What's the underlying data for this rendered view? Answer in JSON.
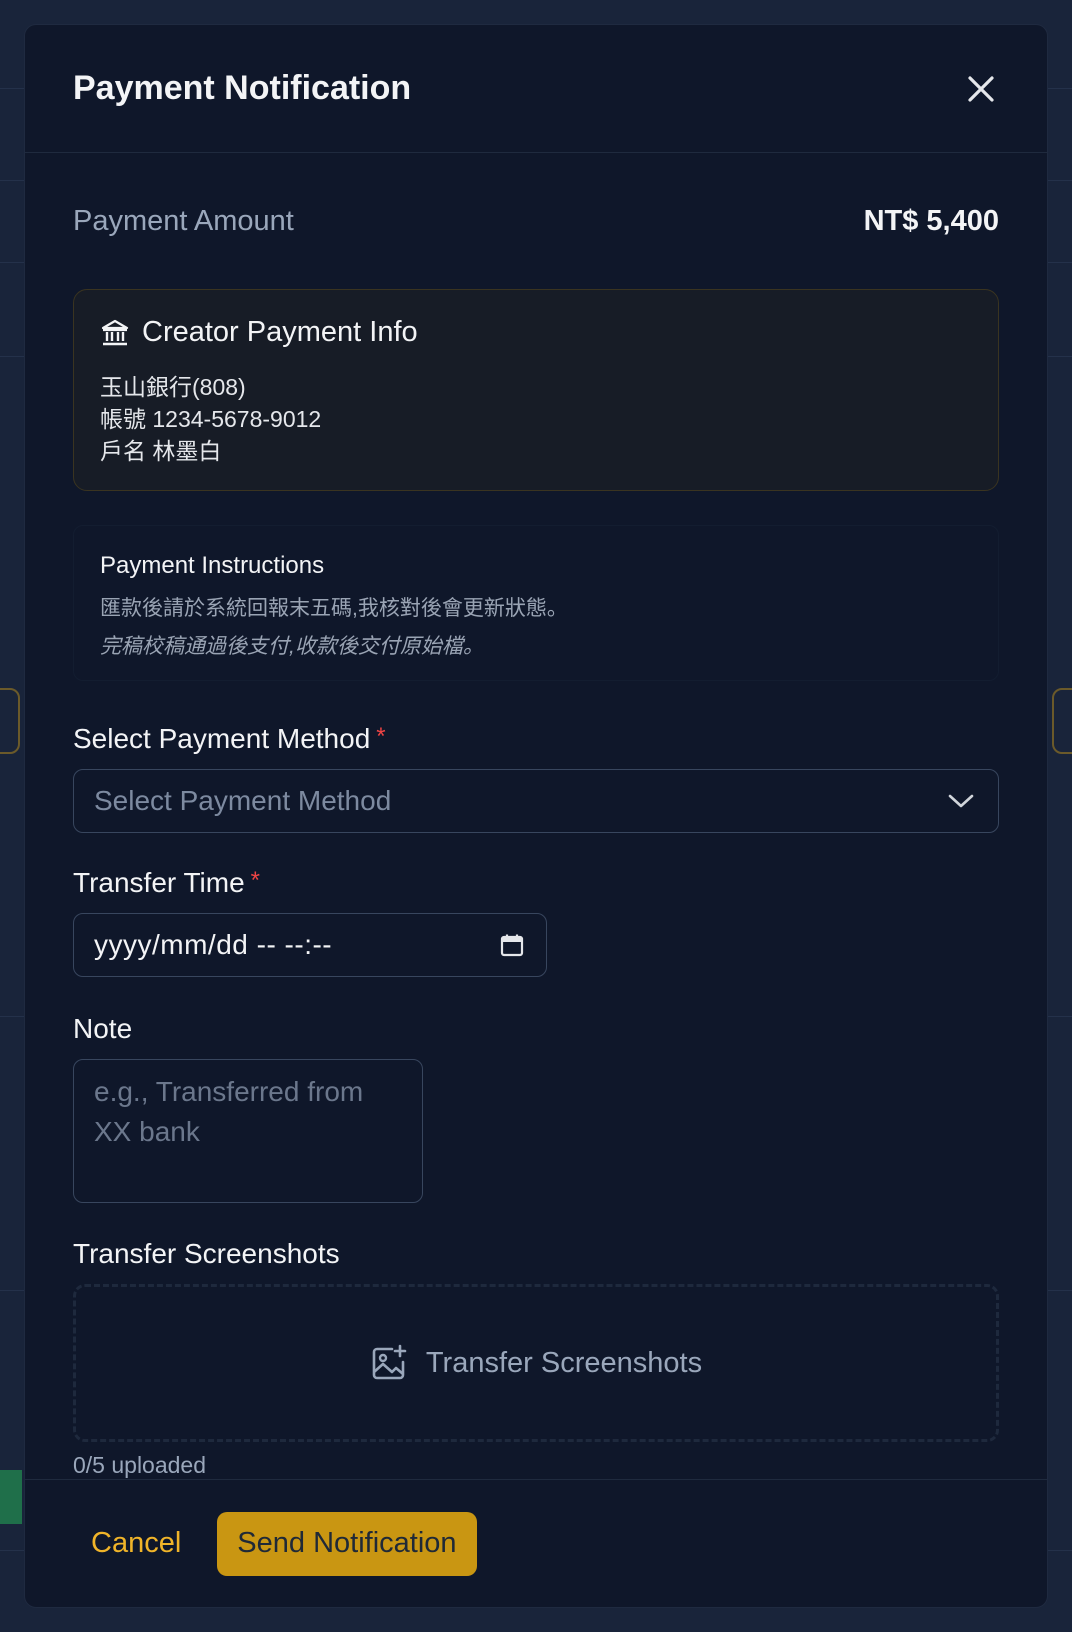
{
  "modal": {
    "title": "Payment Notification"
  },
  "amount": {
    "label": "Payment Amount",
    "value": "NT$ 5,400"
  },
  "creator_info": {
    "title": "Creator Payment Info",
    "icon": "bank-icon",
    "lines": [
      "玉山銀行(808)",
      "帳號 1234-5678-9012",
      "戶名 林墨白"
    ]
  },
  "instructions": {
    "title": "Payment Instructions",
    "line1": "匯款後請於系統回報末五碼,我核對後會更新狀態。",
    "line2": "完稿校稿通過後支付,收款後交付原始檔。"
  },
  "payment_method": {
    "label": "Select Payment Method",
    "required_mark": "*",
    "placeholder": "Select Payment Method"
  },
  "transfer_time": {
    "label": "Transfer Time",
    "required_mark": "*",
    "placeholder": "yyyy/mm/dd -- --:--"
  },
  "note": {
    "label": "Note",
    "placeholder": "e.g., Transferred from XX bank"
  },
  "screenshots": {
    "label": "Transfer Screenshots",
    "dropzone_text": "Transfer Screenshots",
    "count": "0/5 uploaded"
  },
  "footer": {
    "cancel": "Cancel",
    "send": "Send Notification"
  },
  "colors": {
    "accent": "#c99612",
    "cancel": "#f0b429",
    "required": "#ef4444",
    "modal_bg": "#0f172a"
  }
}
